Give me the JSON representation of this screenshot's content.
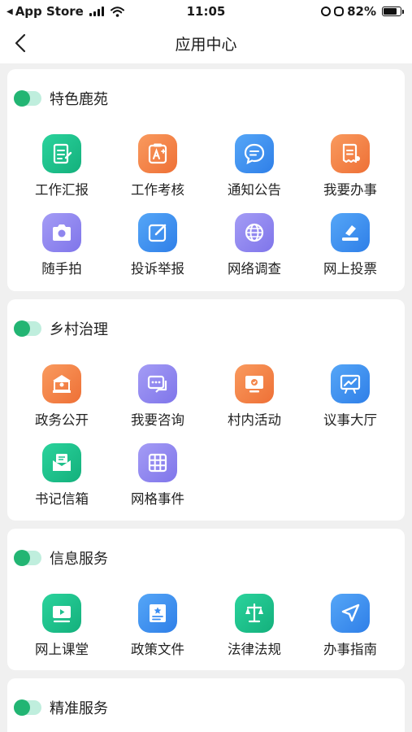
{
  "status_bar": {
    "carrier": "App Store",
    "time": "11:05",
    "battery": "82%",
    "battery_level": 0.82,
    "icons": [
      "back-triangle-icon",
      "signal-icon",
      "wifi-icon",
      "rotation-lock-icon",
      "alarm-icon",
      "battery-icon"
    ]
  },
  "nav": {
    "title": "应用中心",
    "back_icon": "chevron-left-icon"
  },
  "colors": {
    "toggle_on": "#22b573",
    "green": "#1fc08e",
    "orange": "#f4854a",
    "blue": "#3a8df2",
    "purple": "#8f86ef"
  },
  "sections": [
    {
      "title": "特色鹿苑",
      "items": [
        {
          "label": "工作汇报",
          "icon": "report-icon",
          "color": "green"
        },
        {
          "label": "工作考核",
          "icon": "assessment-icon",
          "color": "orange"
        },
        {
          "label": "通知公告",
          "icon": "chat-bubble-icon",
          "color": "blue"
        },
        {
          "label": "我要办事",
          "icon": "receipt-icon",
          "color": "orange"
        },
        {
          "label": "随手拍",
          "icon": "camera-icon",
          "color": "purple"
        },
        {
          "label": "投诉举报",
          "icon": "edit-icon",
          "color": "blue"
        },
        {
          "label": "网络调查",
          "icon": "globe-icon",
          "color": "purple"
        },
        {
          "label": "网上投票",
          "icon": "vote-icon",
          "color": "blue"
        }
      ]
    },
    {
      "title": "乡村治理",
      "items": [
        {
          "label": "政务公开",
          "icon": "government-icon",
          "color": "orange"
        },
        {
          "label": "我要咨询",
          "icon": "consult-icon",
          "color": "purple"
        },
        {
          "label": "村内活动",
          "icon": "monitor-icon",
          "color": "orange"
        },
        {
          "label": "议事大厅",
          "icon": "trend-board-icon",
          "color": "blue"
        },
        {
          "label": "书记信箱",
          "icon": "mailbox-icon",
          "color": "green"
        },
        {
          "label": "网格事件",
          "icon": "grid-icon",
          "color": "purple"
        }
      ]
    },
    {
      "title": "信息服务",
      "items": [
        {
          "label": "网上课堂",
          "icon": "video-icon",
          "color": "green"
        },
        {
          "label": "政策文件",
          "icon": "document-icon",
          "color": "blue"
        },
        {
          "label": "法律法规",
          "icon": "scales-icon",
          "color": "green"
        },
        {
          "label": "办事指南",
          "icon": "navigation-icon",
          "color": "blue"
        }
      ]
    },
    {
      "title": "精准服务",
      "items": []
    }
  ]
}
